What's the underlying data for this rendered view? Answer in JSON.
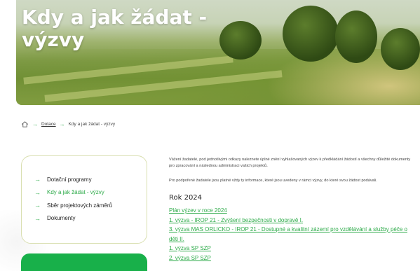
{
  "hero": {
    "title": "Kdy a jak žádat - výzvy"
  },
  "breadcrumb": {
    "home_icon": "home-icon",
    "items": [
      {
        "label": "Dotace"
      },
      {
        "label": "Kdy a jak žádat - výzvy"
      }
    ]
  },
  "sidebar": {
    "items": [
      {
        "label": "Dotační programy",
        "active": false
      },
      {
        "label": "Kdy a jak žádat - výzvy",
        "active": true
      },
      {
        "label": "Sběr projektových záměrů",
        "active": false
      },
      {
        "label": "Dokumenty",
        "active": false
      }
    ]
  },
  "content": {
    "intro": "Vážení žadatelé, pod jednotlivými odkazy naleznete úplné znění vyhlašovaných výzev k předkládání žádostí a všechny důležité dokumenty pro zpracování a následnou administraci vašich projektů.",
    "note": "Pro podpořené žadatele jsou platné vždy ty informace, které jsou uvedeny v rámci výzvy, do které svou žádost podávali.",
    "year_heading": "Rok 2024",
    "links": [
      "Plán výzev v roce 2024",
      "1. výzva - IROP 21 - Zvýšení bezpečnosti v dopravě I.",
      "3. výzva MAS ORLICKO - IROP 21 - Dostupné a kvalitní zázemí pro vzdělávání a služby péče o děti II.",
      "1. výzva SP SZP",
      "2. výzva SP SZP"
    ]
  },
  "colors": {
    "accent": "#2eab4a",
    "green_box": "#18b04a",
    "sidebar_border": "#d9dfb0"
  }
}
